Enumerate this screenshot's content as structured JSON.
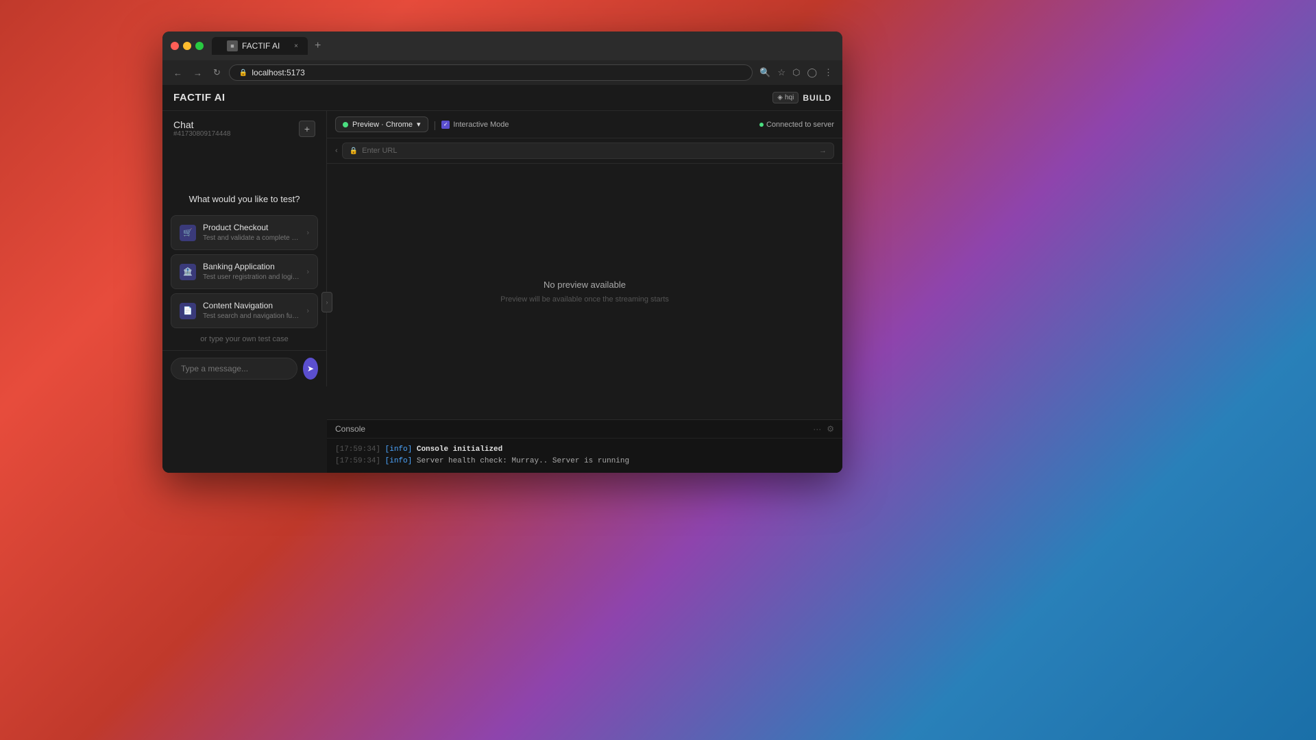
{
  "browser": {
    "tab_title": "FACTIF AI",
    "tab_favicon": "■",
    "address": "localhost:5173",
    "new_tab_label": "+",
    "tab_close": "×"
  },
  "nav": {
    "back": "←",
    "forward": "→",
    "refresh": "↻",
    "search_icon": "🔍",
    "bookmark_icon": "☆",
    "extensions_icon": "⬡",
    "user_icon": "◯",
    "more_icon": "⋮"
  },
  "app": {
    "logo": "FACTIF AI",
    "hqi_label": "hqi",
    "build_label": "BUILD"
  },
  "sidebar": {
    "chat_label": "Chat",
    "chat_id": "#41730809174448",
    "new_chat_icon": "+",
    "test_prompt": "What would you like to test?",
    "or_type": "or type your own test case",
    "test_cases": [
      {
        "id": "product-checkout",
        "title": "Product Checkout",
        "description": "Test and validate a complete purchase flow on fancyadmin.com",
        "icon": "🛒"
      },
      {
        "id": "banking-application",
        "title": "Banking Application",
        "description": "Test user registration and login flow on Parallels, validate account creation form...",
        "icon": "🏦"
      },
      {
        "id": "content-navigation",
        "title": "Content Navigation",
        "description": "Test search and navigation functionality on Wikipedia.org",
        "icon": "📄"
      }
    ],
    "message_placeholder": "Type a message...",
    "send_icon": "➤"
  },
  "toolbar": {
    "preview_label": "Preview · Chrome",
    "preview_dropdown_icon": "▾",
    "separator": "|",
    "interactive_mode_label": "Interactive Mode",
    "connected_label": "Connected to server"
  },
  "url_bar": {
    "placeholder": "Enter URL",
    "lock_icon": "🔒",
    "go_icon": "→",
    "back_icon": "‹"
  },
  "preview": {
    "no_preview_title": "No preview available",
    "no_preview_subtitle": "Preview will be available once the streaming starts"
  },
  "console": {
    "title": "Console",
    "more_icon": "···",
    "settings_icon": "⚙",
    "lines": [
      {
        "time": "[17:59:34]",
        "level": "[info]",
        "message": "Console initialized"
      },
      {
        "time": "[17:59:34]",
        "level": "[info]",
        "message": "Server health check: Murray.. Server is running"
      }
    ]
  },
  "colors": {
    "accent_purple": "#5b4fcf",
    "green_active": "#4ade80",
    "bg_dark": "#1a1a1a",
    "bg_darker": "#141414",
    "border": "#2a2a2a",
    "text_primary": "#e0e0e0",
    "text_secondary": "#aaa",
    "text_muted": "#666",
    "card_bg": "#252525"
  }
}
